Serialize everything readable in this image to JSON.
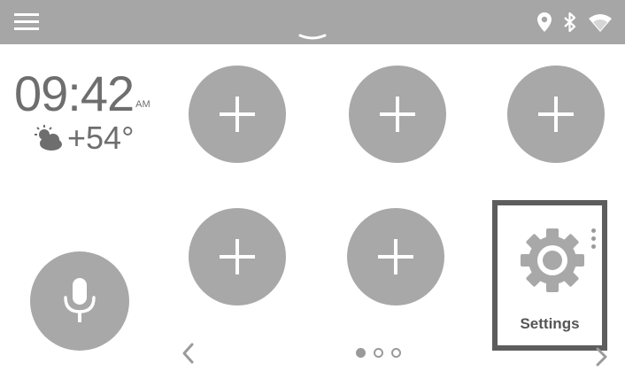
{
  "clock": {
    "time": "09:42",
    "ampm": "AM",
    "temperature": "+54°"
  },
  "settings": {
    "label": "Settings"
  },
  "pager": {
    "pages": 3,
    "active": 0
  },
  "colors": {
    "statusbar": "#a6a6a6",
    "tile": "#a8a8a8",
    "highlight_border": "#5d5d5d",
    "text": "#6e6e6e"
  },
  "icons": {
    "menu": "menu-icon",
    "location": "location-pin-icon",
    "bluetooth": "bluetooth-icon",
    "wifi": "wifi-icon",
    "weather": "partly-cloudy-icon",
    "add": "plus-icon",
    "mic": "microphone-icon",
    "settings": "gear-icon"
  }
}
